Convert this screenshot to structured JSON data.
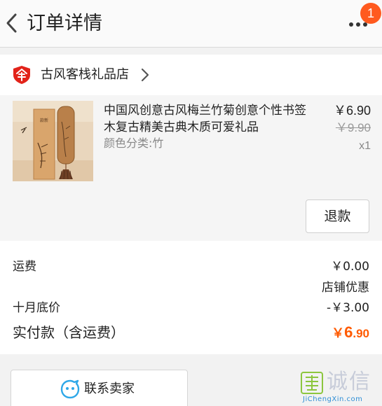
{
  "header": {
    "title": "订单详情",
    "notification_count": "1"
  },
  "shop": {
    "name": "古风客栈礼品店"
  },
  "product": {
    "title": "中国风创意古风梅兰竹菊创意个性书签木复古精美古典木质可爱礼品",
    "variant": "颜色分类:竹",
    "price_current": "￥6.90",
    "price_original": "￥9.90",
    "quantity": "x1",
    "refund_label": "退款"
  },
  "summary": {
    "shipping_label": "运费",
    "shipping_value": "￥0.00",
    "shop_discount_label": "店铺优惠",
    "discount_name": "十月底价",
    "discount_value": "-￥3.00",
    "total_label": "实付款（含运费）",
    "total_currency": "￥",
    "total_int": "6",
    "total_dec": ".90"
  },
  "actions": {
    "contact_seller_label": "联系卖家"
  },
  "watermark": {
    "text": "诚信",
    "url": "JiChengXin.com"
  },
  "colors": {
    "accent": "#ff5a00",
    "badge": "#ff5a1f",
    "shop_icon": "#e2231a",
    "contact_icon": "#2fa8e8"
  },
  "icons": {
    "back": "chevron-left-icon",
    "more": "more-dots-icon",
    "shop": "shop-shield-icon",
    "shop_chevron": "chevron-right-icon",
    "contact": "chat-face-icon"
  }
}
